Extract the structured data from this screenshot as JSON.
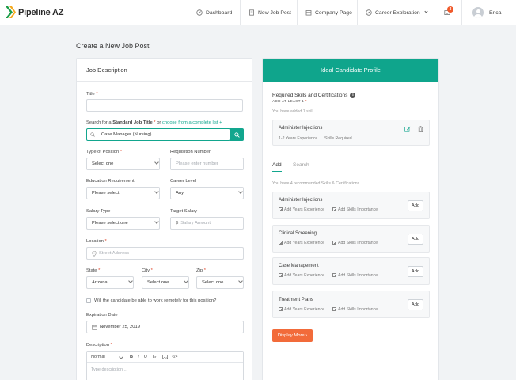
{
  "brand": {
    "name": "Pipeline AZ"
  },
  "nav": {
    "items": [
      {
        "label": "Dashboard",
        "icon": "speedometer-icon"
      },
      {
        "label": "New Job Post",
        "icon": "document-icon"
      },
      {
        "label": "Company Page",
        "icon": "building-icon"
      },
      {
        "label": "Career Exploration",
        "icon": "compass-icon"
      }
    ],
    "notifications_count": "3",
    "user_name": "Erica"
  },
  "page": {
    "title": "Create a New Job Post"
  },
  "job_description": {
    "heading": "Job Description",
    "title_label": "Title",
    "title_value": "",
    "search_prefix": "Search for a",
    "search_bold": "Standard Job Title",
    "search_mid": "or",
    "search_link": "choose from a complete list +",
    "search_value": "Case Manager (Nursing)",
    "type_label": "Type of Position",
    "type_value": "Select one",
    "req_label": "Requisition Number",
    "req_placeholder": "Please enter number",
    "edu_label": "Education Requirement",
    "edu_value": "Please select",
    "career_label": "Career Level",
    "career_value": "Any",
    "salary_type_label": "Salary Type",
    "salary_type_value": "Please select one",
    "target_salary_label": "Target Salary",
    "target_salary_placeholder": "Salary Amount",
    "location_label": "Location",
    "location_placeholder": "Street Address",
    "state_label": "State",
    "state_value": "Arizona",
    "city_label": "City",
    "city_value": "Select one",
    "zip_label": "Zip",
    "zip_value": "Select one",
    "remote_label": "Will the candidate be able to work remotely for this position?",
    "expiration_label": "Expiration Date",
    "expiration_value": "November 25, 2019",
    "description_label": "Description",
    "editor_format": "Normal",
    "description_placeholder": "Type description ..."
  },
  "ideal_candidate": {
    "heading": "Ideal Candidate Profile",
    "skills_title": "Required Skills and Certifications",
    "skills_sub": "ADD AT LEAST 1",
    "added_note": "You have added 1 skill",
    "added_skill": {
      "name": "Administer Injections",
      "years": "1-2 Years Experience",
      "importance": "Skills Required"
    },
    "tabs": [
      {
        "label": "Add"
      },
      {
        "label": "Search"
      }
    ],
    "recommend_note": "You have 4 recommended Skills & Certifications",
    "recommended": [
      {
        "name": "Administer Injections",
        "years_link": "Add Years Experience",
        "importance_link": "Add Skills Importance",
        "button": "Add"
      },
      {
        "name": "Clinical Screening",
        "years_link": "Add Years Experience",
        "importance_link": "Add Skills Importance",
        "button": "Add"
      },
      {
        "name": "Case Management",
        "years_link": "Add Years Experience",
        "importance_link": "Add Skills Importance",
        "button": "Add"
      },
      {
        "name": "Treatment Plans",
        "years_link": "Add Years Experience",
        "importance_link": "Add Skills Importance",
        "button": "Add"
      }
    ],
    "display_more": "Display More ›"
  },
  "colors": {
    "teal": "#0fa58c",
    "orange": "#f26b3a",
    "badge": "#f0592a"
  }
}
